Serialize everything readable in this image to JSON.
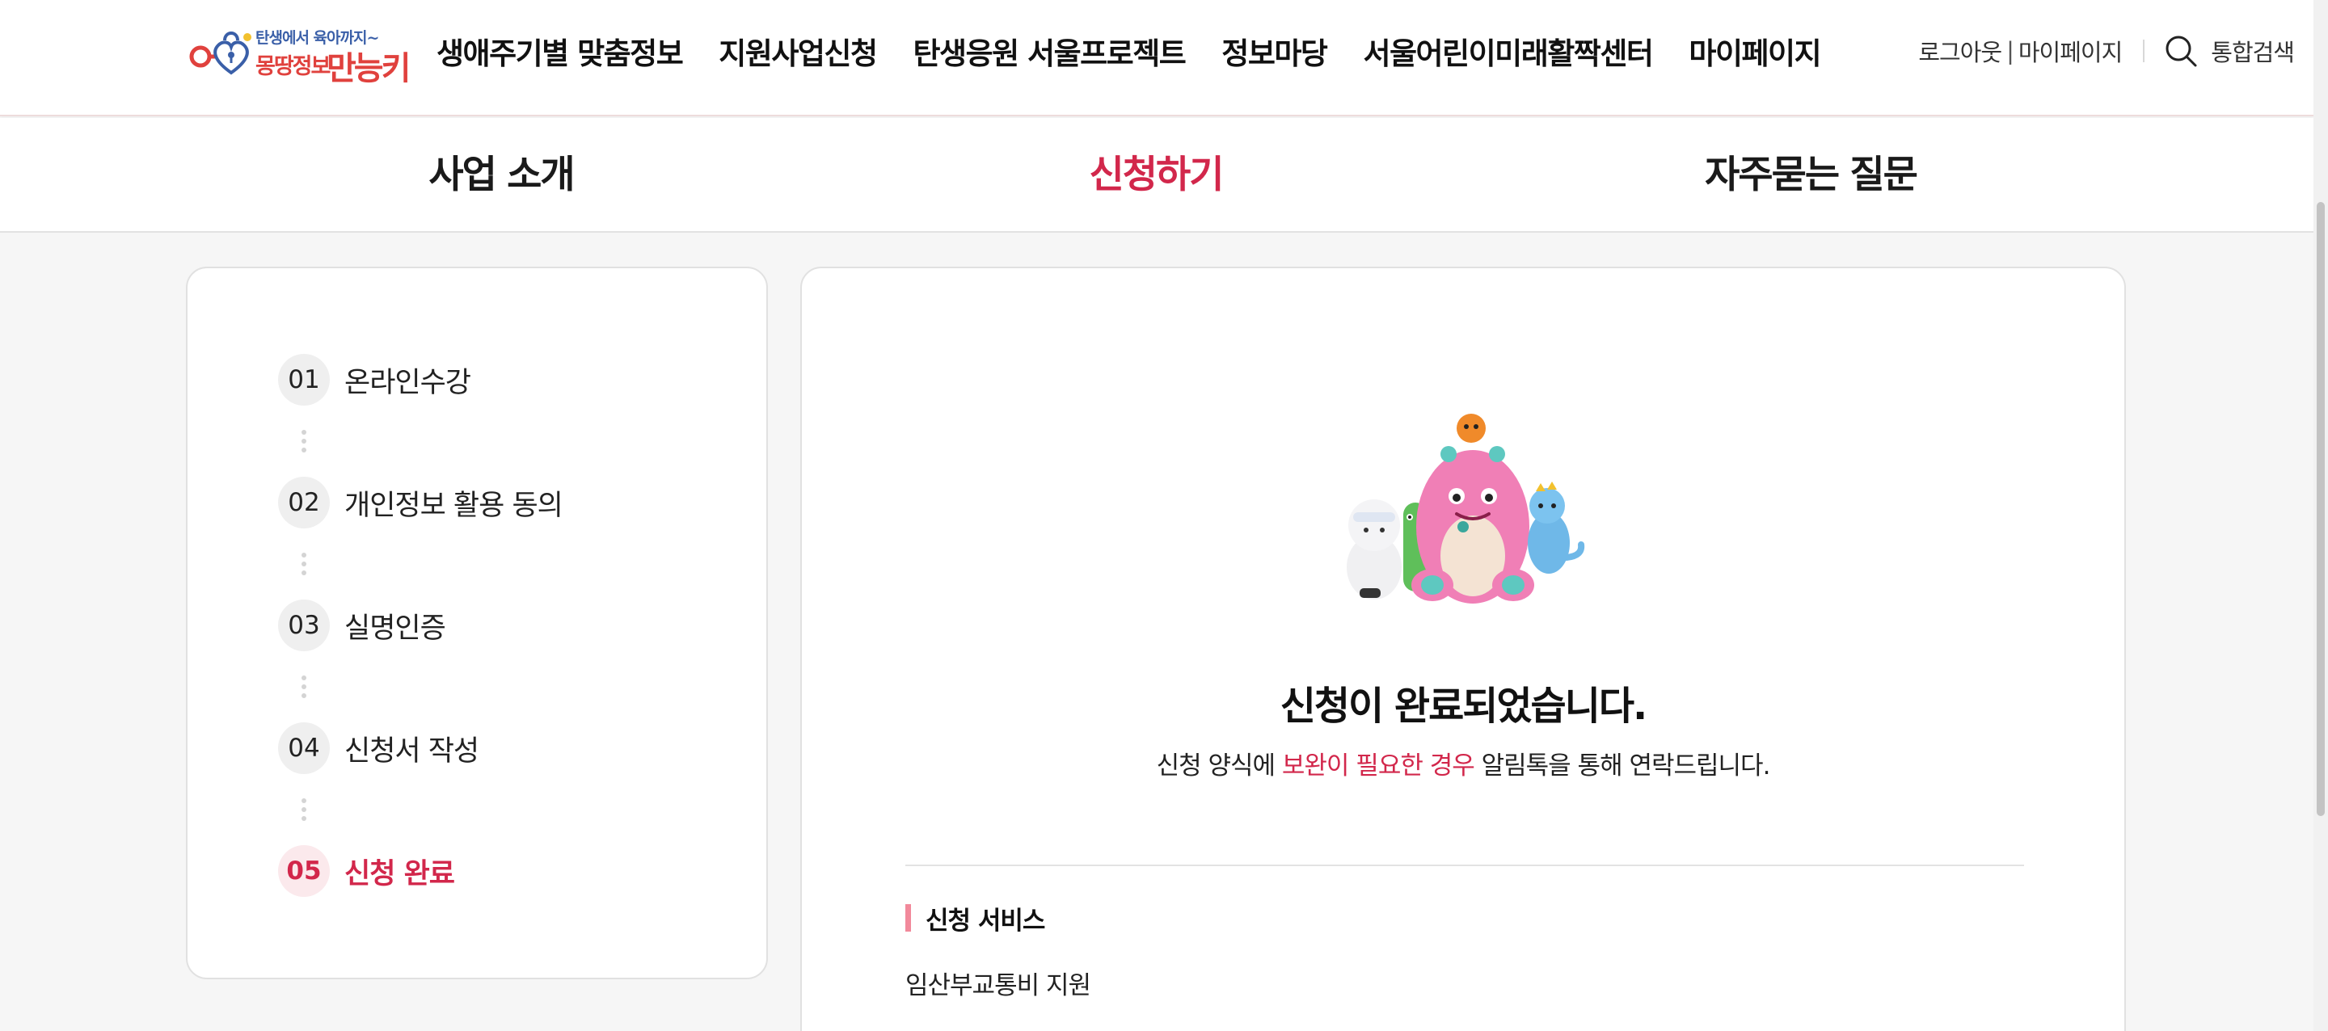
{
  "header": {
    "logo": {
      "slogan": "탄생에서 육아까지~",
      "brand_a": "몽땅정보",
      "brand_b": "만능키"
    },
    "nav": [
      "생애주기별 맞춤정보",
      "지원사업신청",
      "탄생응원 서울프로젝트",
      "정보마당",
      "서울어린이미래활짝센터",
      "마이페이지"
    ],
    "util": {
      "logout": "로그아웃",
      "separator": "|",
      "mypage": "마이페이지",
      "search": "통합검색"
    }
  },
  "subtabs": [
    {
      "label": "사업 소개",
      "active": false
    },
    {
      "label": "신청하기",
      "active": true
    },
    {
      "label": "자주묻는 질문",
      "active": false
    }
  ],
  "steps": [
    {
      "num": "01",
      "label": "온라인수강"
    },
    {
      "num": "02",
      "label": "개인정보 활용 동의"
    },
    {
      "num": "03",
      "label": "실명인증"
    },
    {
      "num": "04",
      "label": "신청서 작성"
    },
    {
      "num": "05",
      "label": "신청 완료",
      "active": true
    }
  ],
  "result": {
    "title": "신청이 완료되었습니다.",
    "desc_before": "신청 양식에 ",
    "desc_highlight": "보완이 필요한 경우",
    "desc_after": " 알림톡을 통해 연락드립니다.",
    "section_label": "신청 서비스",
    "service_name": "임산부교통비 지원"
  },
  "colors": {
    "accent": "#d2274b",
    "accent_soft": "#f2899b",
    "brand_red": "#e0413d",
    "brand_blue": "#3a5fa8"
  },
  "icons": {
    "search": "search-icon",
    "logo": "key-heart-logo-icon",
    "mascots": "mascot-characters-image"
  }
}
